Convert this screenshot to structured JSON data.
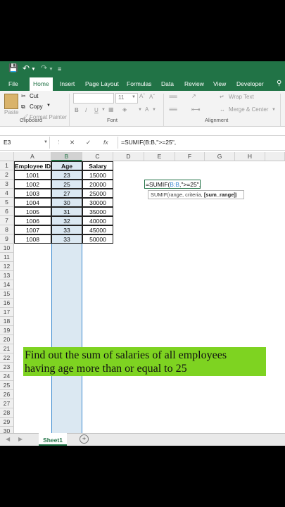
{
  "ribbon_tabs": [
    "File",
    "Home",
    "Insert",
    "Page Layout",
    "Formulas",
    "Data",
    "Review",
    "View",
    "Developer"
  ],
  "active_tab": "Home",
  "clipboard": {
    "cut": "Cut",
    "copy": "Copy",
    "paste": "Paste",
    "format_painter": "Format Painter",
    "group": "Clipboard"
  },
  "font": {
    "size": "11",
    "group": "Font",
    "bold": "B",
    "italic": "I",
    "underline": "U",
    "color_letter": "A"
  },
  "alignment": {
    "wrap": "Wrap Text",
    "merge": "Merge & Center",
    "group": "Alignment"
  },
  "formula_bar": {
    "name_box": "E3",
    "cancel": "✕",
    "enter": "✓",
    "fx": "fx",
    "formula": "=SUMIF(B:B,\">=25\","
  },
  "columns": [
    "A",
    "B",
    "C",
    "D",
    "E",
    "F",
    "G",
    "H"
  ],
  "rows": [
    "1",
    "2",
    "3",
    "4",
    "5",
    "6",
    "7",
    "8",
    "9",
    "10",
    "11",
    "12",
    "13",
    "14",
    "15",
    "16",
    "17",
    "18",
    "19",
    "20",
    "21",
    "22",
    "23",
    "24",
    "25",
    "26",
    "27",
    "28",
    "29",
    "30"
  ],
  "table": {
    "headers": [
      "Employee ID",
      "Age",
      "Salary"
    ],
    "rows": [
      [
        "1001",
        "23",
        "15000"
      ],
      [
        "1002",
        "25",
        "20000"
      ],
      [
        "1003",
        "27",
        "25000"
      ],
      [
        "1004",
        "30",
        "30000"
      ],
      [
        "1005",
        "31",
        "35000"
      ],
      [
        "1006",
        "32",
        "40000"
      ],
      [
        "1007",
        "33",
        "45000"
      ],
      [
        "1008",
        "33",
        "50000"
      ]
    ]
  },
  "editing_cell": {
    "text": "=SUMIF(B:B,\">=25\",",
    "prefix": "=SUMIF(",
    "range_ref": "B:B",
    "suffix": ",\">=25\","
  },
  "tooltip": {
    "prefix": "SUMIF(range, criteria, ",
    "bold": "[sum_range]",
    "suffix": ")"
  },
  "banner": {
    "line1": "Find out the sum of salaries of all employees",
    "line2": "having age more than or equal to 25"
  },
  "sheet_tab": "Sheet1",
  "colors": {
    "excel_green": "#217346",
    "banner_green": "#7ed321",
    "selection_blue": "#dbe8f2"
  }
}
